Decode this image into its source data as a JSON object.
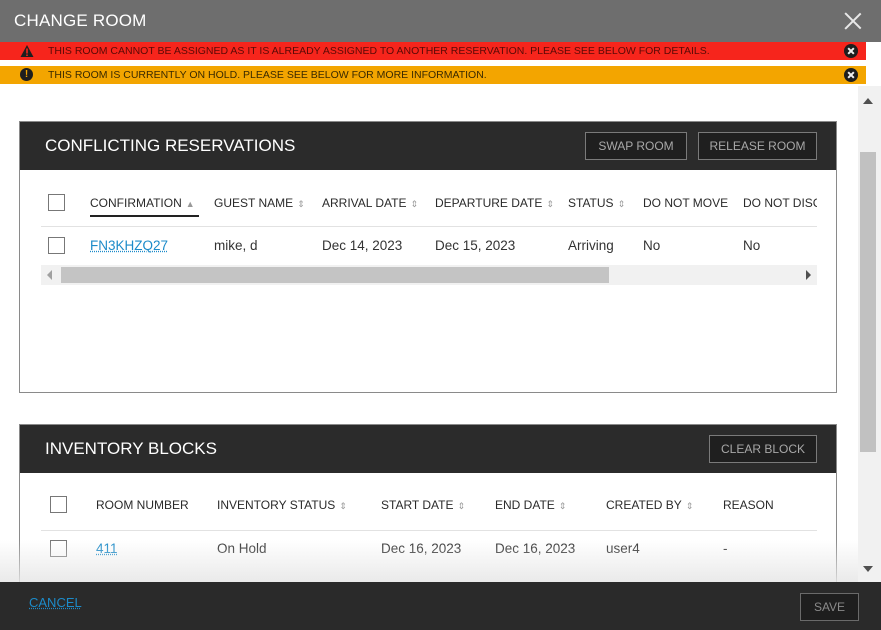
{
  "modal": {
    "title": "CHANGE ROOM",
    "close_icon": "close-icon"
  },
  "alerts": {
    "error": {
      "text": "THIS ROOM CANNOT BE ASSIGNED AS IT IS ALREADY ASSIGNED TO ANOTHER RESERVATION. PLEASE SEE BELOW FOR DETAILS.",
      "icon": "warning-triangle-icon",
      "color": "#f6251c"
    },
    "hold": {
      "text": "THIS ROOM IS CURRENTLY ON HOLD. PLEASE SEE BELOW FOR MORE INFORMATION.",
      "icon": "exclamation-circle-icon",
      "color": "#f3a500"
    }
  },
  "conflicting": {
    "title": "CONFLICTING RESERVATIONS",
    "swap_label": "SWAP ROOM",
    "release_label": "RELEASE ROOM",
    "columns": [
      "CONFIRMATION",
      "GUEST NAME",
      "ARRIVAL DATE",
      "DEPARTURE DATE",
      "STATUS",
      "DO NOT MOVE",
      "DO NOT DISC"
    ],
    "rows": [
      {
        "confirmation": "FN3KHZQ27",
        "guest_name": "mike, d",
        "arrival": "Dec 14, 2023",
        "departure": "Dec 15, 2023",
        "status": "Arriving",
        "do_not_move": "No",
        "do_not_disc": "No"
      }
    ]
  },
  "inventory": {
    "title": "INVENTORY BLOCKS",
    "clear_label": "CLEAR BLOCK",
    "columns": [
      "ROOM NUMBER",
      "INVENTORY STATUS",
      "START DATE",
      "END DATE",
      "CREATED BY",
      "REASON"
    ],
    "rows": [
      {
        "room_number": "411",
        "status": "On Hold",
        "start": "Dec 16, 2023",
        "end": "Dec 16, 2023",
        "created_by": "user4",
        "reason": "-"
      }
    ]
  },
  "footer": {
    "cancel_label": "CANCEL",
    "save_label": "SAVE"
  },
  "colors": {
    "accent_link": "#1c8bc9",
    "header_bg": "#6e6e6e",
    "panel_head_bg": "#2b2b2b"
  }
}
